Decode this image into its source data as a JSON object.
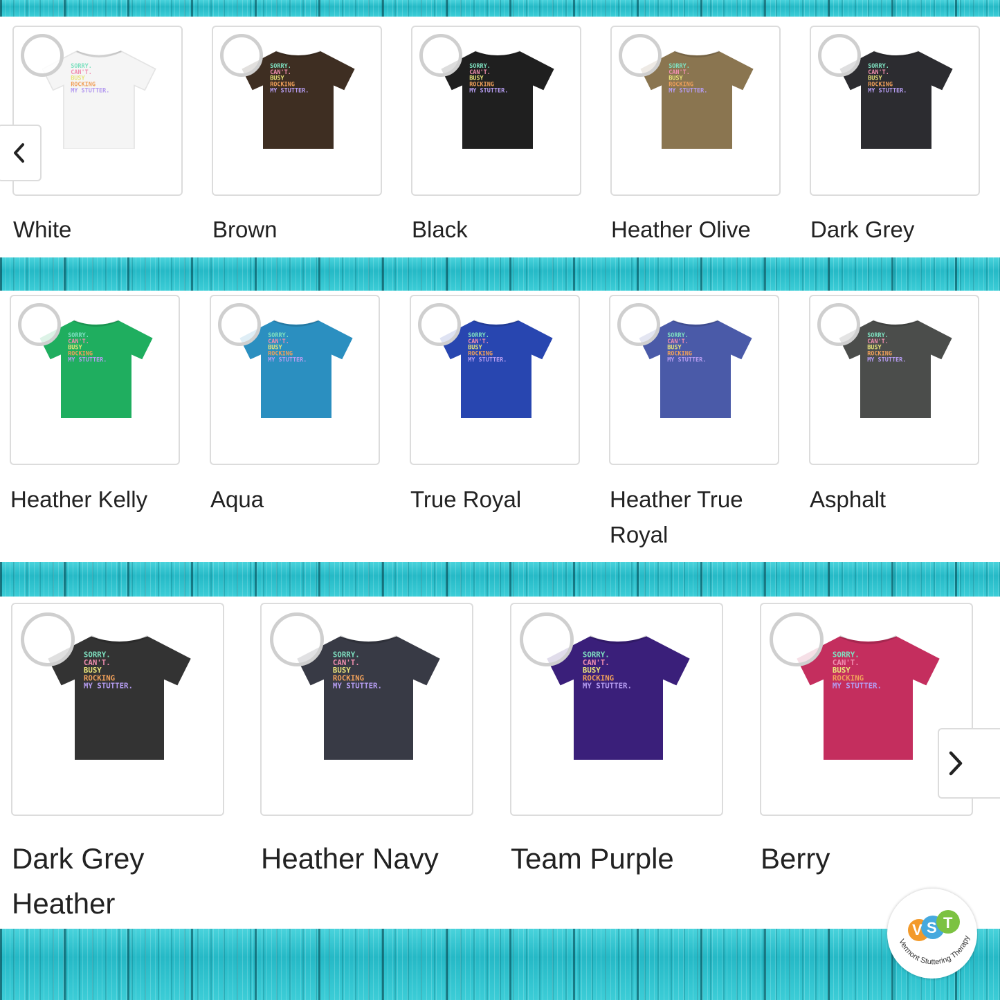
{
  "rows": [
    {
      "items": [
        {
          "label": "White",
          "color": "#f5f5f5"
        },
        {
          "label": "Brown",
          "color": "#3e2e22"
        },
        {
          "label": "Black",
          "color": "#1f1f1f"
        },
        {
          "label": "Heather Olive",
          "color": "#8a7550"
        },
        {
          "label": "Dark Grey",
          "color": "#2c2c30"
        }
      ]
    },
    {
      "items": [
        {
          "label": "Heather Kelly",
          "color": "#1fae5f"
        },
        {
          "label": "Aqua",
          "color": "#2b8fc0"
        },
        {
          "label": "True Royal",
          "color": "#2846b0"
        },
        {
          "label": "Heather True Royal",
          "color": "#4a5aa8"
        },
        {
          "label": "Asphalt",
          "color": "#4b4d4b"
        }
      ]
    },
    {
      "items": [
        {
          "label": "Dark Grey Heather",
          "color": "#333333"
        },
        {
          "label": "Heather Navy",
          "color": "#383a45"
        },
        {
          "label": "Team Purple",
          "color": "#3a1f7a"
        },
        {
          "label": "Berry",
          "color": "#c42e5e"
        }
      ]
    }
  ],
  "shirt_print": [
    "SORRY.",
    "CAN'T.",
    "BUSY",
    "ROCKING",
    "MY STUTTER."
  ],
  "print_colors": [
    "#7fe0c0",
    "#f08fb0",
    "#e9e37a",
    "#f0a05a",
    "#b59cf0"
  ],
  "nav": {
    "prev_icon": "chevron-left-icon",
    "next_icon": "chevron-right-icon"
  },
  "logo": {
    "letters": "VST",
    "caption": "Vermont Stuttering Therapy"
  }
}
